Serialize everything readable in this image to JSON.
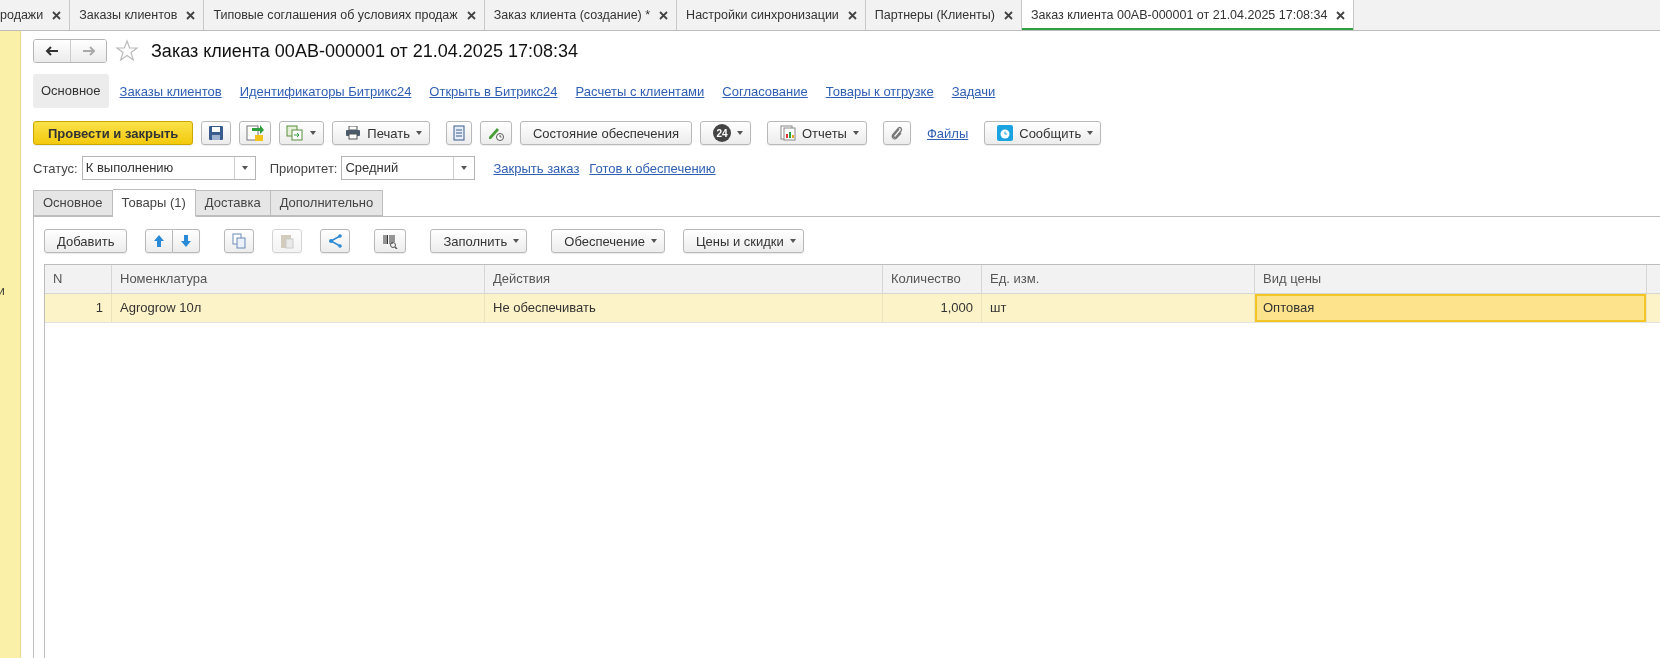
{
  "open_tabs": [
    {
      "label": "родажи",
      "selected": false
    },
    {
      "label": "Заказы клиентов",
      "selected": false
    },
    {
      "label": "Типовые соглашения об условиях продаж",
      "selected": false
    },
    {
      "label": "Заказ клиента (создание) *",
      "selected": false
    },
    {
      "label": "Настройки синхронизации",
      "selected": false
    },
    {
      "label": "Партнеры (Клиенты)",
      "selected": false
    },
    {
      "label": "Заказ клиента 00AB-000001 от 21.04.2025 17:08:34",
      "selected": true
    }
  ],
  "left_panel": {
    "text": "и"
  },
  "title": "Заказ клиента 00AB-000001 от 21.04.2025 17:08:34",
  "nav_links": [
    {
      "label": "Основное",
      "selected": true
    },
    {
      "label": "Заказы клиентов",
      "selected": false
    },
    {
      "label": "Идентификаторы Битрикс24",
      "selected": false
    },
    {
      "label": "Открыть в Битрикс24",
      "selected": false
    },
    {
      "label": "Расчеты с клиентами",
      "selected": false
    },
    {
      "label": "Согласование",
      "selected": false
    },
    {
      "label": "Товары к отгрузке",
      "selected": false
    },
    {
      "label": "Задачи",
      "selected": false
    }
  ],
  "toolbar": {
    "post_close": "Провести и закрыть",
    "print": "Печать",
    "supply_state": "Состояние обеспечения",
    "badge": "24",
    "reports": "Отчеты",
    "files": "Файлы",
    "notify": "Сообщить"
  },
  "status": {
    "label": "Статус:",
    "value": "К выполнению"
  },
  "priority": {
    "label": "Приоритет:",
    "value": "Средний"
  },
  "status_links": [
    "Закрыть заказ",
    "Готов к обеспечению"
  ],
  "form_tabs": [
    {
      "label": "Основное",
      "selected": false
    },
    {
      "label": "Товары (1)",
      "selected": true
    },
    {
      "label": "Доставка",
      "selected": false
    },
    {
      "label": "Дополнительно",
      "selected": false
    }
  ],
  "table_toolbar": {
    "add": "Добавить",
    "fill": "Заполнить",
    "supply": "Обеспечение",
    "prices": "Цены и скидки"
  },
  "table": {
    "columns": [
      {
        "label": "N",
        "kind": "number"
      },
      {
        "label": "Номенклатура",
        "kind": "text"
      },
      {
        "label": "Действия",
        "kind": "text"
      },
      {
        "label": "Количество",
        "kind": "number"
      },
      {
        "label": "Ед. изм.",
        "kind": "text"
      },
      {
        "label": "Вид цены",
        "kind": "text"
      }
    ],
    "rows": [
      {
        "selected": true,
        "cells": [
          {
            "text": "1",
            "current": false
          },
          {
            "text": "Agrogrow 10л",
            "current": false
          },
          {
            "text": "Не обеспечивать",
            "current": false
          },
          {
            "text": "1,000",
            "current": false
          },
          {
            "text": "шт",
            "current": false
          },
          {
            "text": "Оптовая",
            "current": true
          }
        ]
      }
    ]
  }
}
